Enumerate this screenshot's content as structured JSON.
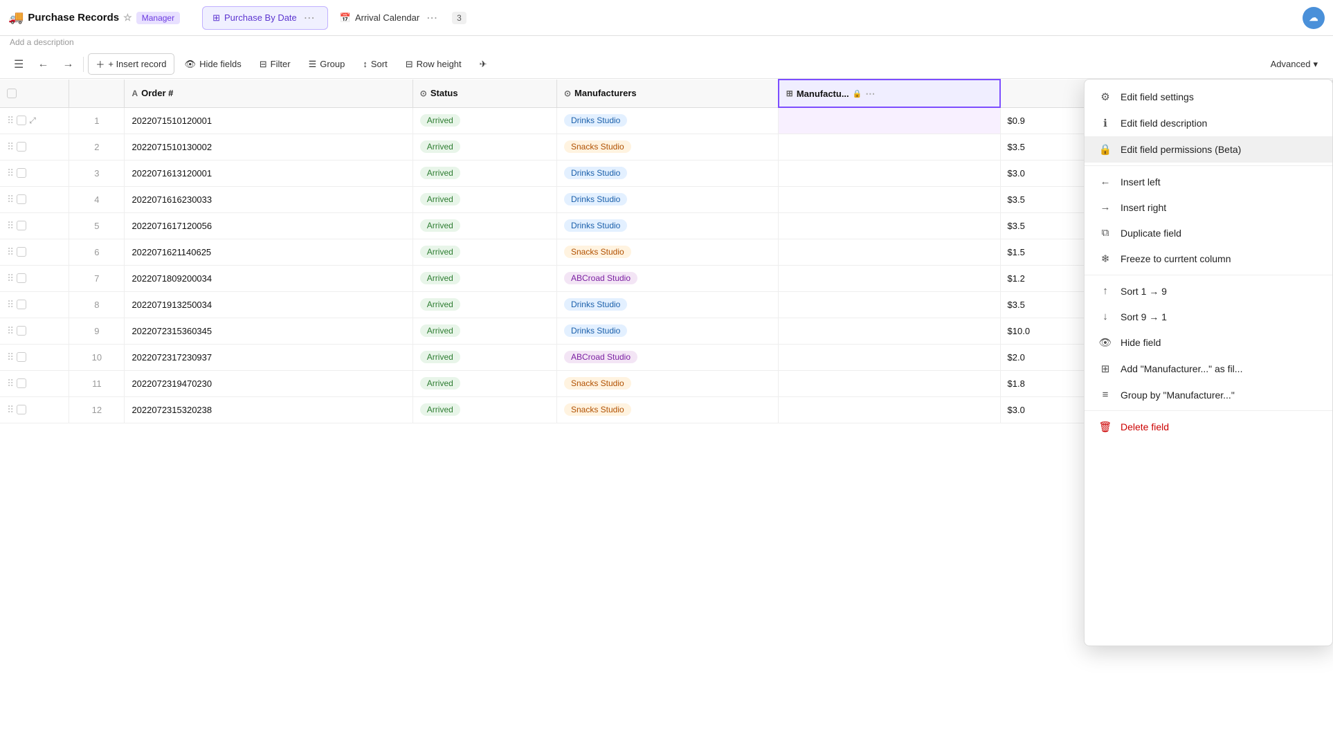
{
  "app": {
    "emoji": "🚚",
    "title": "Purchase Records",
    "badge": "Manager",
    "description": "Add a description"
  },
  "tabs": [
    {
      "id": "purchase-by-date",
      "label": "Purchase By Date",
      "icon": "⊞",
      "active": true
    },
    {
      "id": "arrival-calendar",
      "label": "Arrival Calendar",
      "icon": "📅",
      "active": false
    }
  ],
  "tab_count": "3",
  "toolbar": {
    "insert_record": "+ Insert record",
    "hide_fields": "Hide fields",
    "filter": "Filter",
    "group": "Group",
    "sort": "Sort",
    "row_height": "Row height",
    "advanced": "Advanced"
  },
  "columns": [
    {
      "id": "order_num",
      "label": "Order #",
      "icon": "A",
      "type": "text"
    },
    {
      "id": "status",
      "label": "Status",
      "icon": "⊙",
      "type": "status"
    },
    {
      "id": "manufacturers",
      "label": "Manufacturers",
      "icon": "⊙",
      "type": "link"
    },
    {
      "id": "manufactu_extra",
      "label": "Manufactu...",
      "icon": "⊞",
      "type": "special",
      "locked": true
    }
  ],
  "rows": [
    {
      "num": 1,
      "order": "2022071510120001",
      "status": "Arrived",
      "manufacturer": "Drinks Studio",
      "mfr_type": "drinks",
      "price": "$0.9"
    },
    {
      "num": 2,
      "order": "2022071510130002",
      "status": "Arrived",
      "manufacturer": "Snacks Studio",
      "mfr_type": "snacks",
      "price": "$3.5"
    },
    {
      "num": 3,
      "order": "2022071613120001",
      "status": "Arrived",
      "manufacturer": "Drinks Studio",
      "mfr_type": "drinks",
      "price": "$3.0"
    },
    {
      "num": 4,
      "order": "2022071616230033",
      "status": "Arrived",
      "manufacturer": "Drinks Studio",
      "mfr_type": "drinks",
      "price": "$3.5"
    },
    {
      "num": 5,
      "order": "2022071617120056",
      "status": "Arrived",
      "manufacturer": "Drinks Studio",
      "mfr_type": "drinks",
      "price": "$3.5"
    },
    {
      "num": 6,
      "order": "2022071621140625",
      "status": "Arrived",
      "manufacturer": "Snacks Studio",
      "mfr_type": "snacks",
      "price": "$1.5"
    },
    {
      "num": 7,
      "order": "2022071809200034",
      "status": "Arrived",
      "manufacturer": "ABCroad Studio",
      "mfr_type": "abc",
      "price": "$1.2"
    },
    {
      "num": 8,
      "order": "2022071913250034",
      "status": "Arrived",
      "manufacturer": "Drinks Studio",
      "mfr_type": "drinks",
      "price": "$3.5"
    },
    {
      "num": 9,
      "order": "2022072315360345",
      "status": "Arrived",
      "manufacturer": "Drinks Studio",
      "mfr_type": "drinks",
      "price": "$10.0"
    },
    {
      "num": 10,
      "order": "2022072317230937",
      "status": "Arrived",
      "manufacturer": "ABCroad Studio",
      "mfr_type": "abc",
      "price": "$2.0"
    },
    {
      "num": 11,
      "order": "2022072319470230",
      "status": "Arrived",
      "manufacturer": "Snacks Studio",
      "mfr_type": "snacks",
      "price": "$1.8"
    },
    {
      "num": 12,
      "order": "2022072315320238",
      "status": "Arrived",
      "manufacturer": "Snacks Studio",
      "mfr_type": "snacks",
      "price": "$3.0"
    }
  ],
  "context_menu": {
    "items": [
      {
        "id": "edit-field-settings",
        "label": "Edit field settings",
        "icon": "⚙"
      },
      {
        "id": "edit-field-description",
        "label": "Edit field description",
        "icon": "ℹ"
      },
      {
        "id": "edit-field-permissions",
        "label": "Edit field permissions (Beta)",
        "icon": "🔒"
      },
      {
        "id": "insert-left",
        "label": "Insert left",
        "icon": "←"
      },
      {
        "id": "insert-right",
        "label": "Insert right",
        "icon": "→"
      },
      {
        "id": "duplicate-field",
        "label": "Duplicate field",
        "icon": "⧉"
      },
      {
        "id": "freeze-column",
        "label": "Freeze to currtent column",
        "icon": "❄"
      },
      {
        "id": "sort-asc",
        "label": "Sort 1 → 9",
        "icon": "↑"
      },
      {
        "id": "sort-desc",
        "label": "Sort 9 → 1",
        "icon": "↓"
      },
      {
        "id": "hide-field",
        "label": "Hide field",
        "icon": "⊙"
      },
      {
        "id": "add-as-filter",
        "label": "Add \"Manufacturer...\" as fil...",
        "icon": "⊞"
      },
      {
        "id": "group-by",
        "label": "Group by \"Manufacturer...\"",
        "icon": "≡"
      },
      {
        "id": "delete-field",
        "label": "Delete field",
        "icon": "🗑"
      }
    ]
  }
}
